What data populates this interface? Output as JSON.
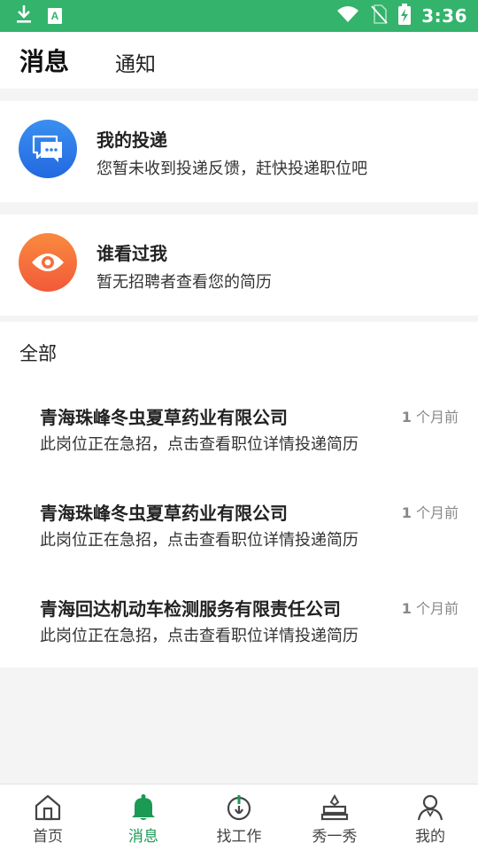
{
  "status_bar": {
    "time": "3:36",
    "icons": [
      "download-icon",
      "a-icon",
      "wifi-icon",
      "no-sim-icon",
      "battery-charging-icon"
    ]
  },
  "header": {
    "tab_messages": "消息",
    "tab_notifications": "通知"
  },
  "cards": [
    {
      "title": "我的投递",
      "desc": "您暂未收到投递反馈，赶快投递职位吧",
      "icon": "chat-bubble-icon",
      "color": "#2f80ed"
    },
    {
      "title": "谁看过我",
      "desc": "暂无招聘者查看您的简历",
      "icon": "eye-icon",
      "color": "#f5703a"
    }
  ],
  "all_section": {
    "label": "全部",
    "messages": [
      {
        "company": "青海珠峰冬虫夏草药业有限公司",
        "time_num": "1",
        "time_unit": " 个月前",
        "sub": "此岗位正在急招，点击查看职位详情投递简历"
      },
      {
        "company": "青海珠峰冬虫夏草药业有限公司",
        "time_num": "1",
        "time_unit": " 个月前",
        "sub": "此岗位正在急招，点击查看职位详情投递简历"
      },
      {
        "company": "青海回达机动车检测服务有限责任公司",
        "time_num": "1",
        "time_unit": " 个月前",
        "sub": "此岗位正在急招，点击查看职位详情投递简历"
      }
    ]
  },
  "tabbar": {
    "items": [
      {
        "label": "首页",
        "icon": "home-icon"
      },
      {
        "label": "消息",
        "icon": "bell-icon",
        "active": true
      },
      {
        "label": "找工作",
        "icon": "job-search-icon"
      },
      {
        "label": "秀一秀",
        "icon": "show-icon"
      },
      {
        "label": "我的",
        "icon": "profile-icon"
      }
    ]
  },
  "colors": {
    "status_bar": "#33b36b",
    "active_tab": "#1a9a55",
    "bubble": "#2f80ed",
    "eye": "#f5703a"
  }
}
